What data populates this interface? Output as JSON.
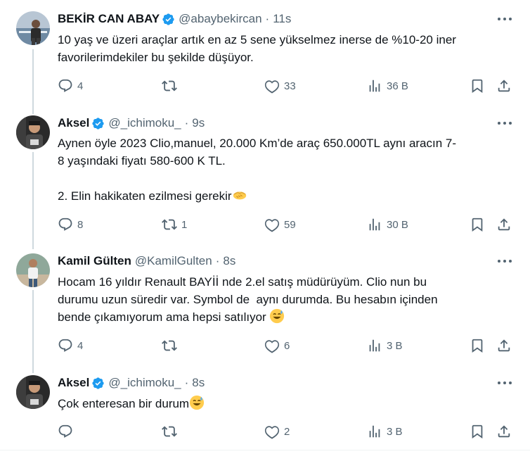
{
  "colors": {
    "verified": "#1d9bf0",
    "text": "#0f1419",
    "muted": "#536471",
    "thread_line": "#cfd9de"
  },
  "tweets": [
    {
      "name": "BEKİR CAN ABAY",
      "verified": true,
      "handle": "@abaybekircan",
      "time": "11s",
      "lines": [
        "10 yaş ve üzeri araçlar artık en az 5 sene yükselmez inerse de %10-20 iner",
        "favorilerimdekiler bu şekilde düşüyor."
      ],
      "replies": "4",
      "reposts": "",
      "likes": "33",
      "views": "36 B"
    },
    {
      "name": "Aksel",
      "verified": true,
      "handle": "@_ichimoku_",
      "time": "9s",
      "lines": [
        "Aynen öyle 2023 Clio,manuel, 20.000 Km’de araç 650.000TL aynı aracın 7-",
        "8 yaşındaki fiyatı 580-600 K TL.",
        "",
        "2. Elin hakikaten ezilmesi gerekir"
      ],
      "emoji": "handshake",
      "replies": "8",
      "reposts": "1",
      "likes": "59",
      "views": "30 B"
    },
    {
      "name": "Kamil Gülten",
      "verified": false,
      "handle": "@KamilGulten",
      "time": "8s",
      "lines": [
        "Hocam 16 yıldır Renault BAYİİ nde 2.el satış müdürüyüm. Clio nun bu",
        "durumu uzun süredir var. Symbol de  aynı durumda. Bu hesabın içinden",
        "bende çıkamıyorum ama hepsi satılıyor "
      ],
      "emoji": "sweat-smile",
      "replies": "4",
      "reposts": "",
      "likes": "6",
      "views": "3 B"
    },
    {
      "name": "Aksel",
      "verified": true,
      "handle": "@_ichimoku_",
      "time": "8s",
      "lines": [
        "Çok enteresan bir durum"
      ],
      "emoji": "sweat-smile",
      "replies": "",
      "reposts": "",
      "likes": "2",
      "views": "3 B"
    }
  ]
}
